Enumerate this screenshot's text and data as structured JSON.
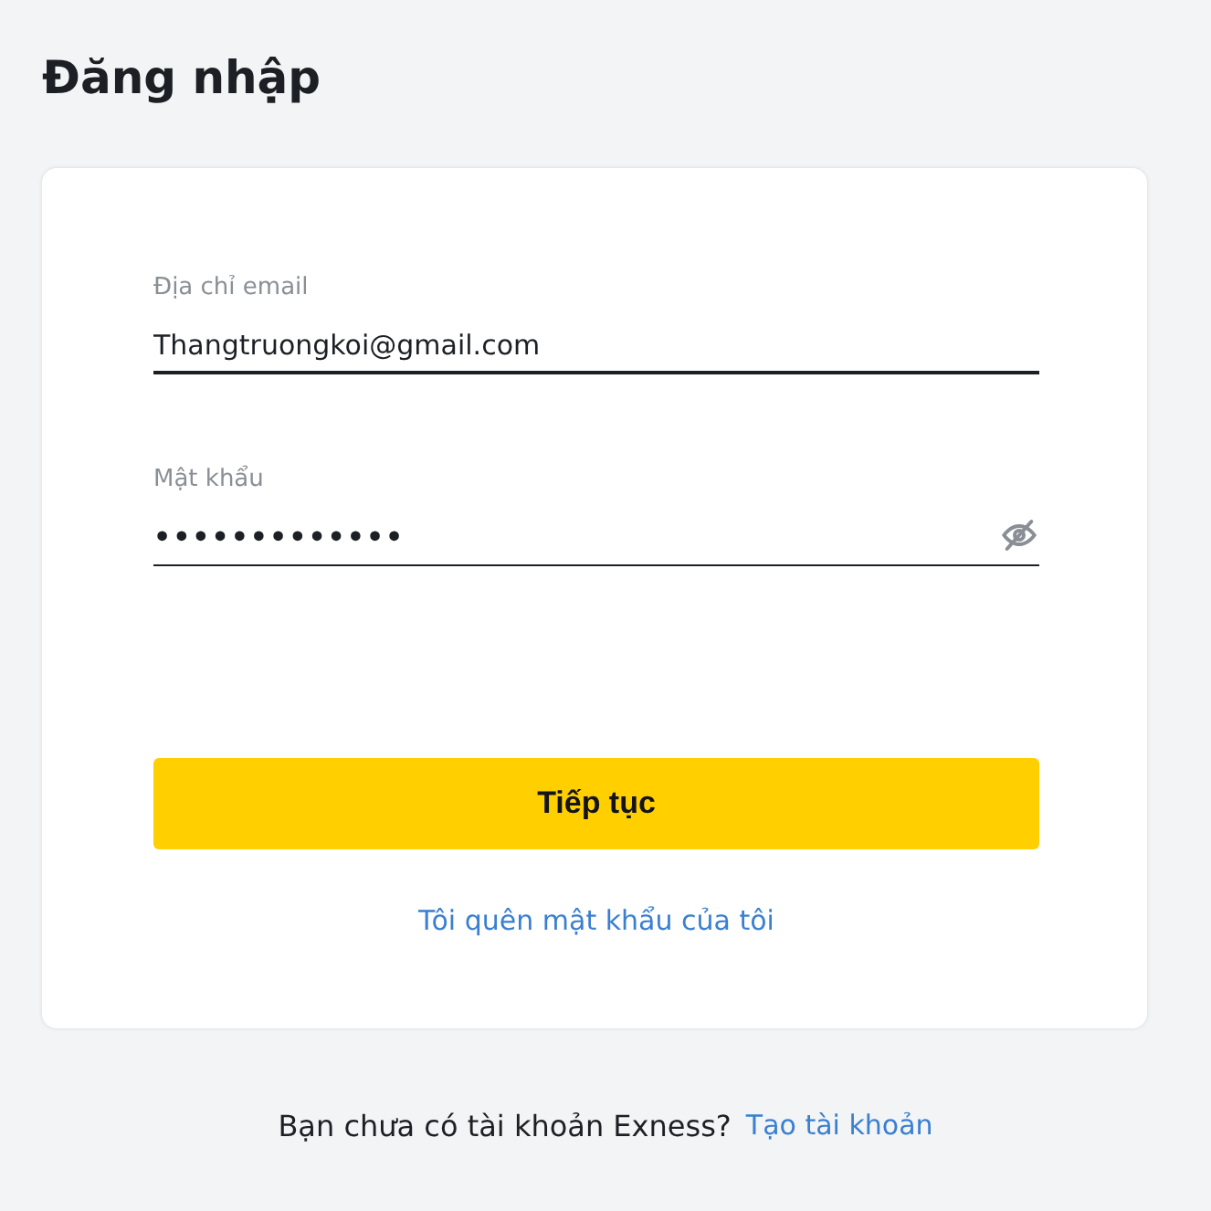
{
  "page_title": "Đăng nhập",
  "fields": [
    {
      "label": "Địa chỉ email",
      "value": "Thangtruongkoi@gmail.com",
      "kind": "text",
      "focused": true
    },
    {
      "label": "Mật khẩu",
      "value": "•••••••••••••",
      "kind": "password",
      "focused": false
    }
  ],
  "submit_button": "Tiếp tục",
  "forgot_link": "Tôi quên mật khẩu của tôi",
  "footer": {
    "text": "Bạn chưa có tài khoản Exness?",
    "link": "Tạo tài khoản"
  }
}
